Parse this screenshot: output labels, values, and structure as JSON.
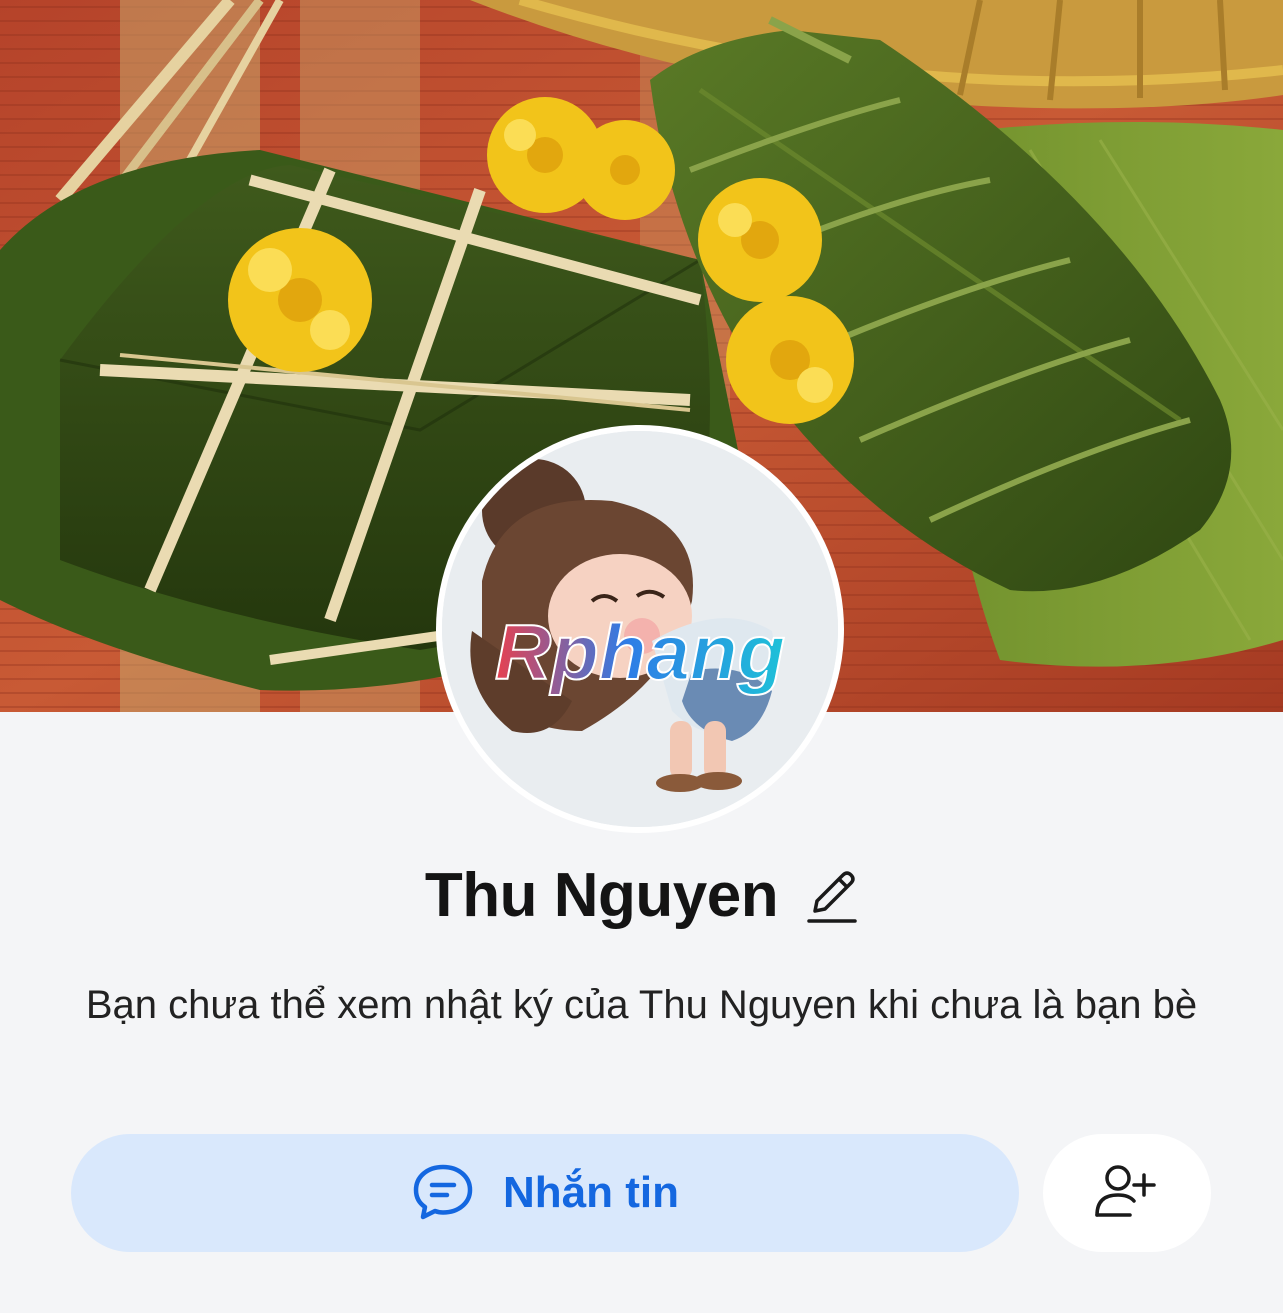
{
  "profile": {
    "name": "Thu Nguyen",
    "notice": "Bạn chưa thể xem nhật ký của Thu Nguyen khi chưa là bạn bè",
    "avatar_watermark": "Rphang"
  },
  "actions": {
    "message_label": "Nhắn tin",
    "message_icon": "chat-bubble-icon",
    "add_friend_icon": "add-friend-icon",
    "edit_icon": "pencil-icon"
  },
  "colors": {
    "background": "#f4f5f7",
    "primary_blue": "#1467e0",
    "button_tint": "#d9e8fc"
  }
}
